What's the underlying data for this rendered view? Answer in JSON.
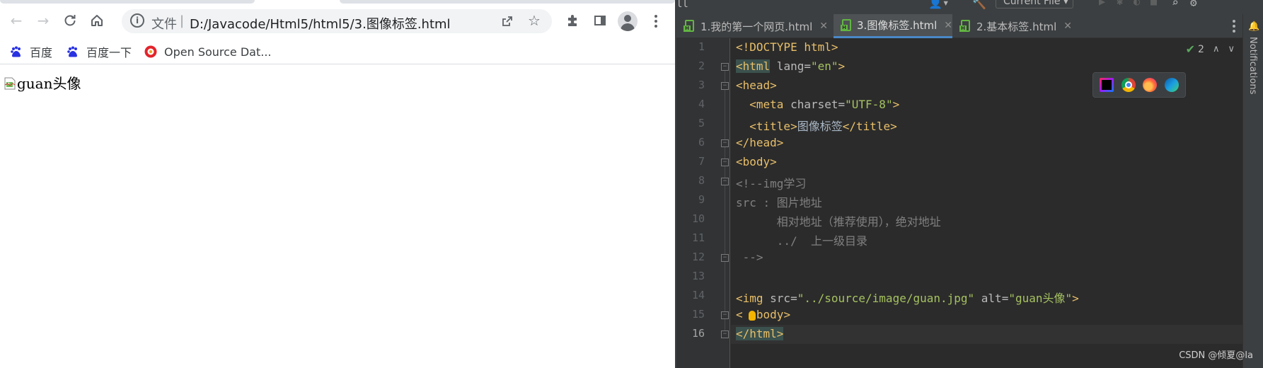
{
  "browser": {
    "address_bar": {
      "scheme_label": "文件",
      "separator": "|",
      "url": "D:/Javacode/Html5/html5/3.图像标签.html"
    },
    "bookmarks": [
      {
        "label": "百度",
        "icon": "baidu-paw-icon"
      },
      {
        "label": "百度一下",
        "icon": "baidu-paw-icon"
      },
      {
        "label": "Open Source Dat...",
        "icon": "open-source-data-icon"
      }
    ],
    "page": {
      "broken_image_alt": "guan头像"
    }
  },
  "ide": {
    "toolbar": {
      "run_config": "Current File"
    },
    "tabs": [
      {
        "label": "1.我的第一个网页.html",
        "active": false
      },
      {
        "label": "3.图像标签.html",
        "active": true
      },
      {
        "label": "2.基本标签.html",
        "active": false
      }
    ],
    "inspections": {
      "count": "2"
    },
    "gutter": {
      "line_numbers": [
        "1",
        "2",
        "3",
        "4",
        "5",
        "6",
        "7",
        "8",
        "9",
        "10",
        "11",
        "12",
        "13",
        "14",
        "15",
        "16"
      ]
    },
    "code": {
      "l1": "<!DOCTYPE html>",
      "l2_open": "<html",
      "l2_attr": " lang=",
      "l2_val": "\"en\"",
      "l2_close": ">",
      "l3": "<head>",
      "l4_open": "<meta",
      "l4_attr": " charset=",
      "l4_val": "\"UTF-8\"",
      "l4_close": ">",
      "l5_open": "<title>",
      "l5_text": "图像标签",
      "l5_close": "</title>",
      "l6": "</head>",
      "l7": "<body>",
      "l8": "<!--img学习",
      "l9": "src : 图片地址",
      "l10": "      相对地址（推荐使用），绝对地址",
      "l11": "      ../  上一级目录",
      "l12": " -->",
      "l14_open": "<img",
      "l14_attr1": " src=",
      "l14_val1": "\"../source/image/guan.jpg\"",
      "l14_attr2": " alt=",
      "l14_val2": "\"guan头像\"",
      "l14_close": ">",
      "l15_lt": "<",
      "l15_rest": "body>",
      "l16": "</html>"
    },
    "notifications_label": "Notifications",
    "watermark": "CSDN @倾夏@la"
  },
  "colors": {
    "tag": "#e8bf6a",
    "attribute": "#bababa",
    "string": "#a5c261",
    "comment": "#808080",
    "editor_bg": "#2b2b2b",
    "active_tab_underline": "#4a88c7"
  }
}
